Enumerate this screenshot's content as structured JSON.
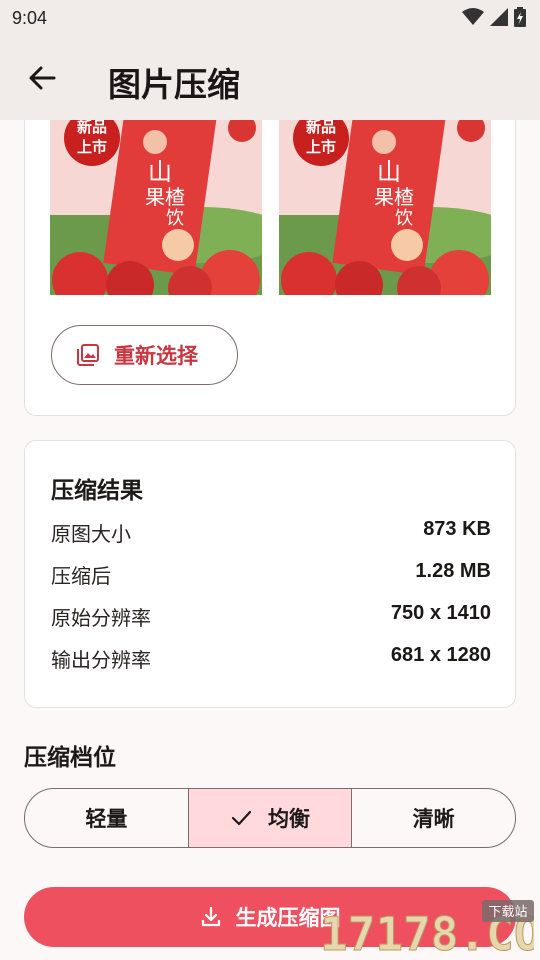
{
  "status_bar": {
    "time": "9:04"
  },
  "app_bar": {
    "title": "图片压缩"
  },
  "preview": {
    "poster_badge_line1": "新品",
    "poster_badge_line2": "上市",
    "poster_text_line1": "山",
    "poster_text_line2": "果楂",
    "poster_text_line3": "饮"
  },
  "reselect_button": {
    "label": "重新选择"
  },
  "result": {
    "title": "压缩结果",
    "rows": [
      {
        "label": "原图大小",
        "value": "873 KB"
      },
      {
        "label": "压缩后",
        "value": "1.28 MB"
      },
      {
        "label": "原始分辨率",
        "value": "750 x 1410"
      },
      {
        "label": "输出分辨率",
        "value": "681 x 1280"
      }
    ]
  },
  "levels": {
    "title": "压缩档位",
    "options": [
      "轻量",
      "均衡",
      "清晰"
    ],
    "selected": "均衡"
  },
  "generate_button": {
    "label": "生成压缩图"
  },
  "watermark": {
    "text": "17178.COM",
    "tag": "下载站"
  },
  "colors": {
    "accent": "#ef5060",
    "selected_segment": "#ffd9dc",
    "label_red": "#c8363f"
  }
}
